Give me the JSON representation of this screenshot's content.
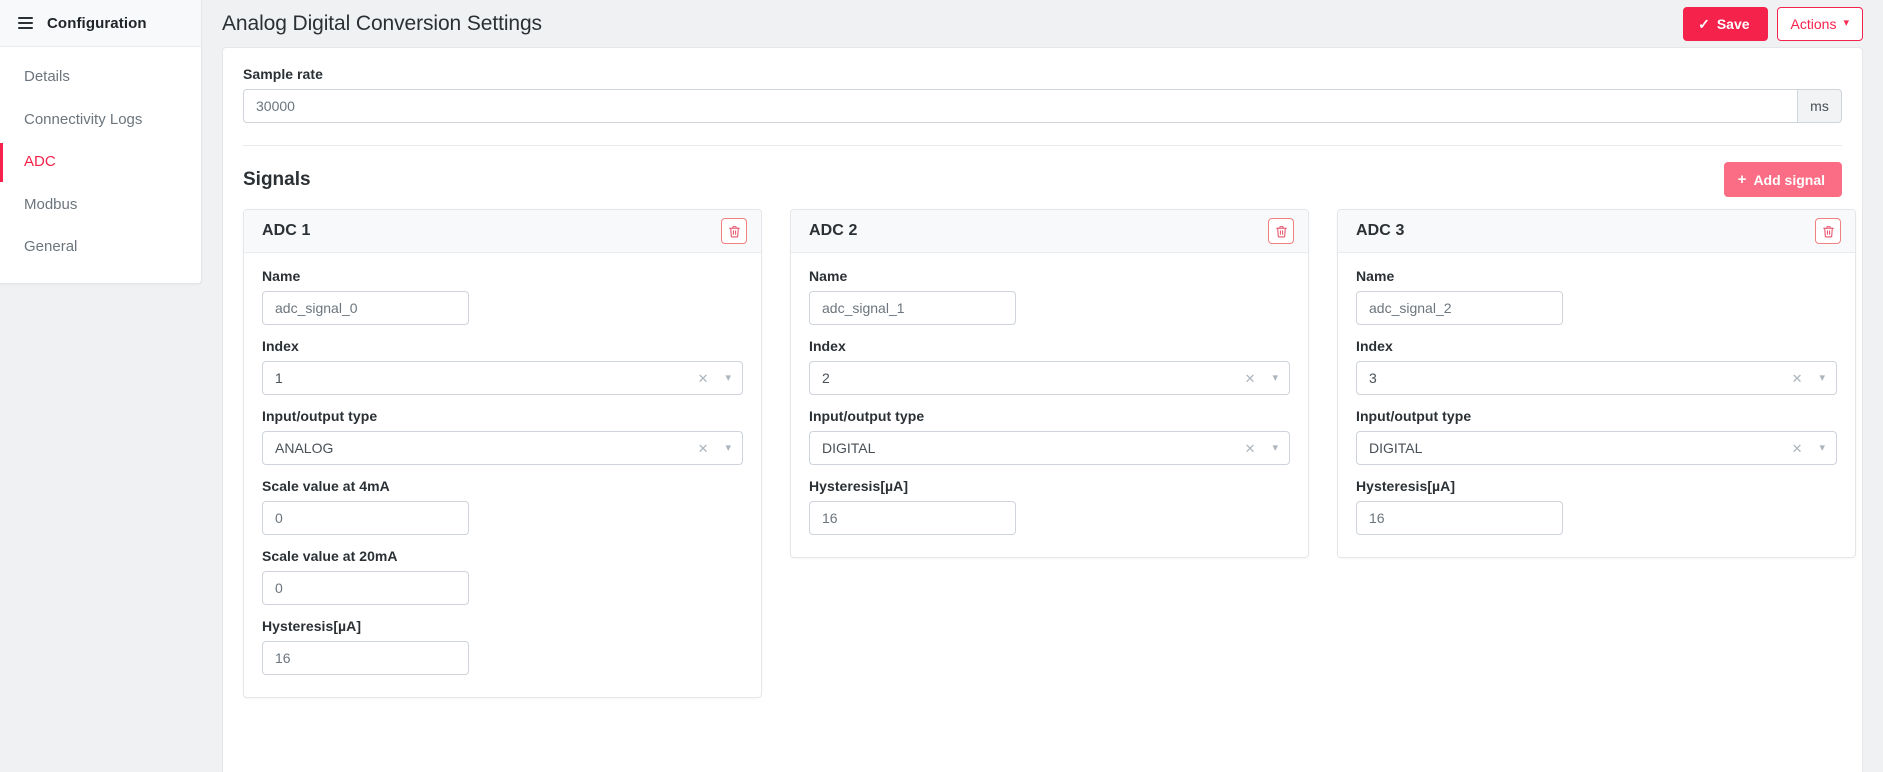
{
  "sidebar": {
    "menu_icon": "hamburger-icon",
    "title": "Configuration",
    "items": [
      {
        "label": "Details",
        "active": false
      },
      {
        "label": "Connectivity Logs",
        "active": false
      },
      {
        "label": "ADC",
        "active": true
      },
      {
        "label": "Modbus",
        "active": false
      },
      {
        "label": "General",
        "active": false
      }
    ]
  },
  "topbar": {
    "page_title": "Analog Digital Conversion Settings",
    "save_label": "Save",
    "save_icon": "check-icon",
    "actions_label": "Actions",
    "actions_icon": "chevron-down-icon"
  },
  "form": {
    "sample_rate": {
      "label": "Sample rate",
      "value": "30000",
      "placeholder": "Sample rate",
      "unit": "ms"
    }
  },
  "signals": {
    "title": "Signals",
    "add_label": "Add signal",
    "add_icon": "plus-icon",
    "delete_icon": "trash-icon",
    "select_clear_icon": "clear-x-icon",
    "select_arrow_icon": "chevron-down-icon",
    "labels": {
      "name": "Name",
      "index": "Index",
      "io_type": "Input/output type",
      "scale_4ma": "Scale value at 4mA",
      "scale_20ma": "Scale value at 20mA",
      "hysteresis": "Hysteresis[µA]"
    },
    "cards": [
      {
        "title": "ADC 1",
        "name": "adc_signal_0",
        "index": "1",
        "io_type": "ANALOG",
        "scale_4ma": "0",
        "scale_20ma": "0",
        "hysteresis": "16"
      },
      {
        "title": "ADC 2",
        "name": "adc_signal_1",
        "index": "2",
        "io_type": "DIGITAL",
        "hysteresis": "16"
      },
      {
        "title": "ADC 3",
        "name": "adc_signal_2",
        "index": "3",
        "io_type": "DIGITAL",
        "hysteresis": "16"
      }
    ]
  },
  "colors": {
    "accent": "#f5224b",
    "accent_light": "#fb6d84",
    "danger_outline": "#f08080",
    "page_bg": "#f0f1f3",
    "panel_bg": "#ffffff",
    "muted_text": "#6c757d"
  }
}
